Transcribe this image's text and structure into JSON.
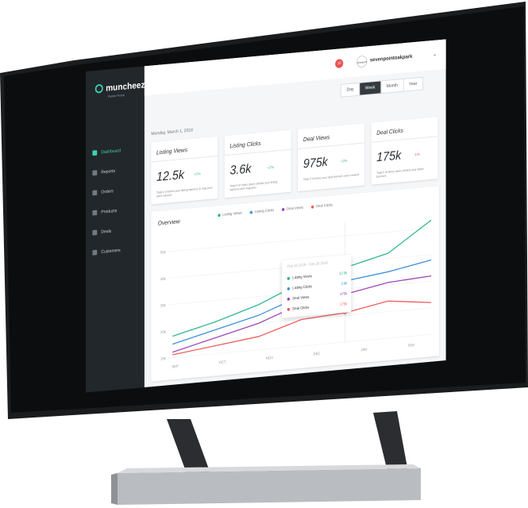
{
  "brand": {
    "name": "muncheez",
    "tagline": "Partner Portal",
    "accent": "#3fd1b0"
  },
  "sidebar": {
    "items": [
      {
        "label": "Dashboard",
        "icon": "dashboard-icon",
        "active": true
      },
      {
        "label": "Reports",
        "icon": "reports-icon"
      },
      {
        "label": "Orders",
        "icon": "orders-icon"
      },
      {
        "label": "Products",
        "icon": "products-icon"
      },
      {
        "label": "Deals",
        "icon": "deals-icon"
      },
      {
        "label": "Customers",
        "icon": "customers-icon"
      }
    ]
  },
  "topbar": {
    "notifications": "10",
    "account": "sevenpointoakpark",
    "avatar_text": "sevenpoint"
  },
  "ranges": [
    "Day",
    "Week",
    "Month",
    "Year"
  ],
  "active_range": "Week",
  "date": "Monday, March 1, 2018",
  "cards": [
    {
      "title": "Listing Views",
      "value": "12.5k",
      "delta": "+2%",
      "delta_color": "#3fb98a",
      "desc": "Total # of times your listing banners & map pins were viewed"
    },
    {
      "title": "Listing Clicks",
      "value": "3.6k",
      "delta": "+2%",
      "delta_color": "#3fb98a",
      "desc": "Total # of times users clicked your listing banners and map pins."
    },
    {
      "title": "Deal Views",
      "value": "975k",
      "delta": "+2%",
      "delta_color": "#3fb98a",
      "desc": "Total # of times your deal banners were viewed"
    },
    {
      "title": "Deal Clicks",
      "value": "175k",
      "delta": "-1%",
      "delta_color": "#e8524f",
      "desc": "Total # of times users clicked your deals banners"
    }
  ],
  "overview": {
    "title": "Overview",
    "tooltip": {
      "header": "Feb 15 2018 - Feb 28 2018",
      "rows": [
        {
          "label": "Listing Views",
          "value": "12.5k",
          "color": "#2bb58e"
        },
        {
          "label": "Listing Clicks",
          "value": "3.6k",
          "color": "#3b8fd9"
        },
        {
          "label": "Deal Views",
          "value": "975k",
          "color": "#9b45b5"
        },
        {
          "label": "Deal Clicks",
          "value": "175k",
          "color": "#ef5b5b"
        }
      ]
    }
  },
  "chart_data": {
    "type": "line",
    "x": [
      "SEP",
      "OCT",
      "NOV",
      "DEC",
      "JAN",
      "FEB"
    ],
    "yticks": [
      "10k",
      "20k",
      "30k",
      "40k",
      "50k"
    ],
    "ylim": [
      10,
      55
    ],
    "grid": true,
    "legend_position": "top",
    "series": [
      {
        "name": "Listing Views",
        "color": "#2bb58e",
        "values": [
          18,
          22,
          27,
          34,
          38,
          42,
          53
        ]
      },
      {
        "name": "Listing Clicks",
        "color": "#3b8fd9",
        "values": [
          15,
          19,
          23,
          29,
          33,
          35,
          38
        ]
      },
      {
        "name": "Deal Views",
        "color": "#9b45b5",
        "values": [
          12,
          16,
          20,
          26,
          28,
          31,
          32
        ]
      },
      {
        "name": "Deal Clicks",
        "color": "#ef5b5b",
        "values": [
          11,
          13,
          15,
          20,
          21,
          24,
          22
        ]
      }
    ]
  }
}
